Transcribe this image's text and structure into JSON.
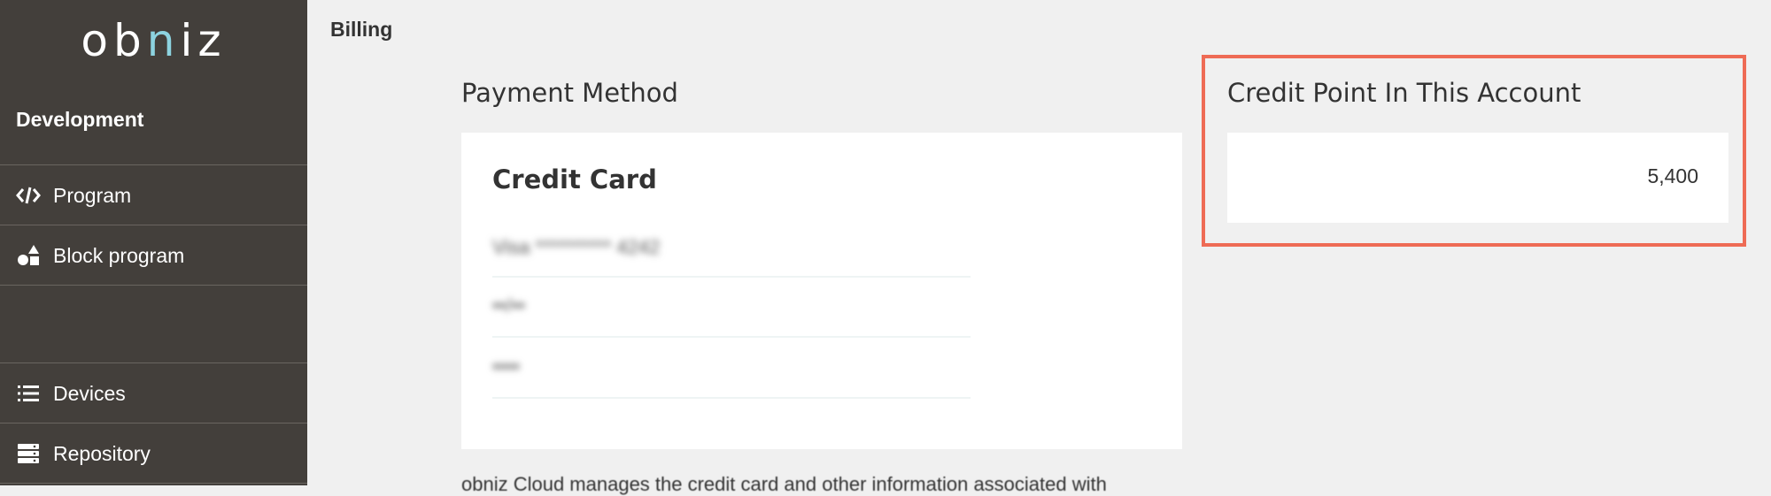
{
  "sidebar": {
    "logo": {
      "left": "ob",
      "accent": "n",
      "right": "iz"
    },
    "section_title": "Development",
    "items": [
      {
        "label": "Program",
        "icon": "code-icon"
      },
      {
        "label": "Block program",
        "icon": "shapes-icon"
      },
      {
        "label": "Devices",
        "icon": "list-icon"
      },
      {
        "label": "Repository",
        "icon": "server-icon"
      }
    ]
  },
  "header": {
    "title": "Billing"
  },
  "payment": {
    "heading": "Payment Method",
    "card_title": "Credit Card",
    "rows": [
      "Visa ********** 4242",
      "••/••",
      "••••"
    ],
    "footnote": "obniz Cloud manages the credit card and other information associated with"
  },
  "credit": {
    "heading": "Credit Point In This Account",
    "value": "5,400"
  },
  "colors": {
    "sidebar_bg": "#433f3b",
    "logo_accent": "#8dd3e0",
    "highlight_border": "#ee6b55",
    "page_bg": "#f0f0f0"
  }
}
